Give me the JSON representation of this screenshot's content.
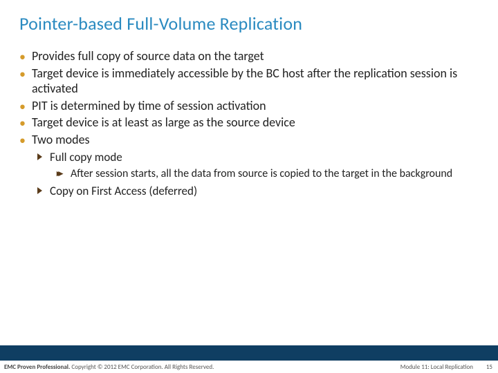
{
  "title": "Pointer-based Full-Volume Replication",
  "bullets": {
    "b1": "Provides full copy of source data on the target",
    "b2": "Target device is immediately accessible by the BC host after the replication session is activated",
    "b3": "PIT is determined by time of session activation",
    "b4": "Target device is at least as large as the source device",
    "b5": "Two modes",
    "s1": "Full copy mode",
    "s1a": "After session starts, all the data from source is copied to the target in the background",
    "s2": "Copy on First Access (deferred)"
  },
  "footer": {
    "left_bold": "EMC Proven Professional.",
    "left_rest": " Copyright © 2012 EMC Corporation. All Rights Reserved.",
    "right": "Module 11: Local Replication",
    "page": "15"
  }
}
